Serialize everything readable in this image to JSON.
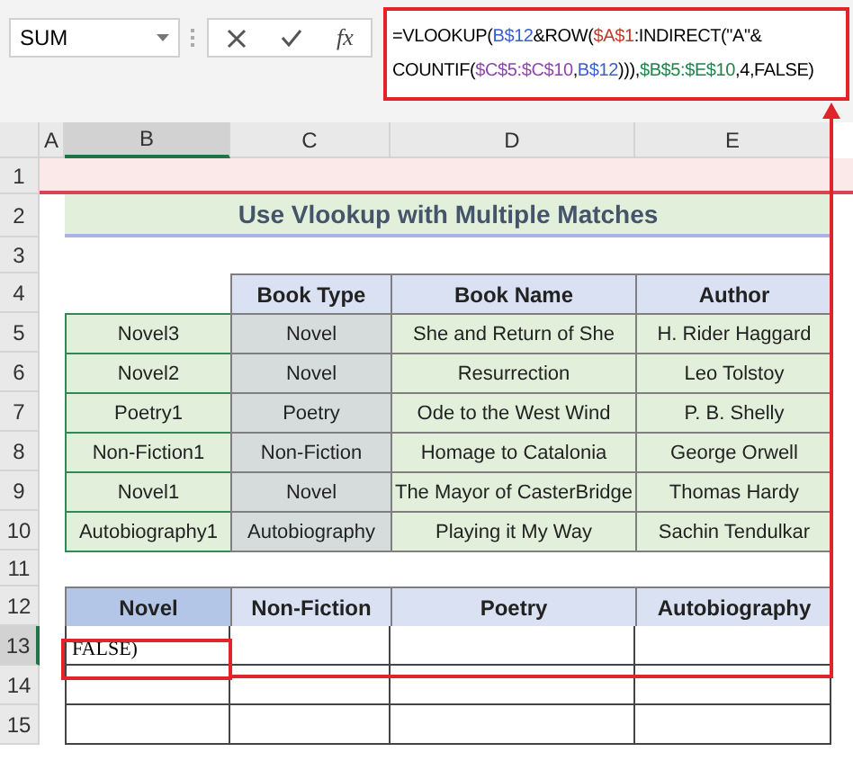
{
  "formula_bar": {
    "name_box": "SUM",
    "function_label": "fx",
    "formula": [
      [
        {
          "text": "=VLOOKUP("
        },
        {
          "text": "B$12",
          "color": "#3a5fcd"
        },
        {
          "text": "&ROW("
        },
        {
          "text": "$A$1",
          "color": "#c0392b"
        },
        {
          "text": ":INDIRECT(\"A\"&"
        }
      ],
      [
        {
          "text": "COUNTIF("
        },
        {
          "text": "$C$5:$C$10",
          "color": "#8e44ad"
        },
        {
          "text": ","
        },
        {
          "text": "B$12",
          "color": "#3a5fcd"
        },
        {
          "text": "))),"
        },
        {
          "text": "$B$5:$E$10",
          "color": "#1e8449"
        },
        {
          "text": ",4,FALSE)"
        }
      ]
    ]
  },
  "columns": [
    {
      "label": "A",
      "selected": false
    },
    {
      "label": "B",
      "selected": true
    },
    {
      "label": "C",
      "selected": false
    },
    {
      "label": "D",
      "selected": false
    },
    {
      "label": "E",
      "selected": false
    }
  ],
  "rows": [
    {
      "number": "1",
      "selected": false,
      "kind": "band"
    },
    {
      "number": "2",
      "selected": false,
      "kind": "title",
      "title": "Use Vlookup with Multiple Matches"
    },
    {
      "number": "3",
      "selected": false,
      "kind": "blank"
    },
    {
      "number": "4",
      "selected": false,
      "kind": "table_header",
      "cells": [
        "Book Type",
        "Book Name",
        "Author"
      ]
    },
    {
      "number": "5",
      "selected": false,
      "kind": "data",
      "cells": [
        "Novel3",
        "Novel",
        "She and Return of She",
        "H. Rider Haggard"
      ]
    },
    {
      "number": "6",
      "selected": false,
      "kind": "data",
      "cells": [
        "Novel2",
        "Novel",
        "Resurrection",
        "Leo Tolstoy"
      ]
    },
    {
      "number": "7",
      "selected": false,
      "kind": "data",
      "cells": [
        "Poetry1",
        "Poetry",
        "Ode to the West Wind",
        "P. B. Shelly"
      ]
    },
    {
      "number": "8",
      "selected": false,
      "kind": "data",
      "cells": [
        "Non-Fiction1",
        "Non-Fiction",
        "Homage to Catalonia",
        "George Orwell"
      ]
    },
    {
      "number": "9",
      "selected": false,
      "kind": "data",
      "cells": [
        "Novel1",
        "Novel",
        "The Mayor of CasterBridge",
        "Thomas Hardy"
      ]
    },
    {
      "number": "10",
      "selected": false,
      "kind": "data",
      "cells": [
        "Autobiography1",
        "Autobiography",
        "Playing it My Way",
        "Sachin Tendulkar"
      ]
    },
    {
      "number": "11",
      "selected": false,
      "kind": "blank"
    },
    {
      "number": "12",
      "selected": false,
      "kind": "result_header",
      "cells": [
        "Novel",
        "Non-Fiction",
        "Poetry",
        "Autobiography"
      ]
    },
    {
      "number": "13",
      "selected": true,
      "kind": "result",
      "cells": [
        "FALSE)"
      ]
    },
    {
      "number": "14",
      "selected": false,
      "kind": "result"
    },
    {
      "number": "15",
      "selected": false,
      "kind": "result"
    }
  ]
}
